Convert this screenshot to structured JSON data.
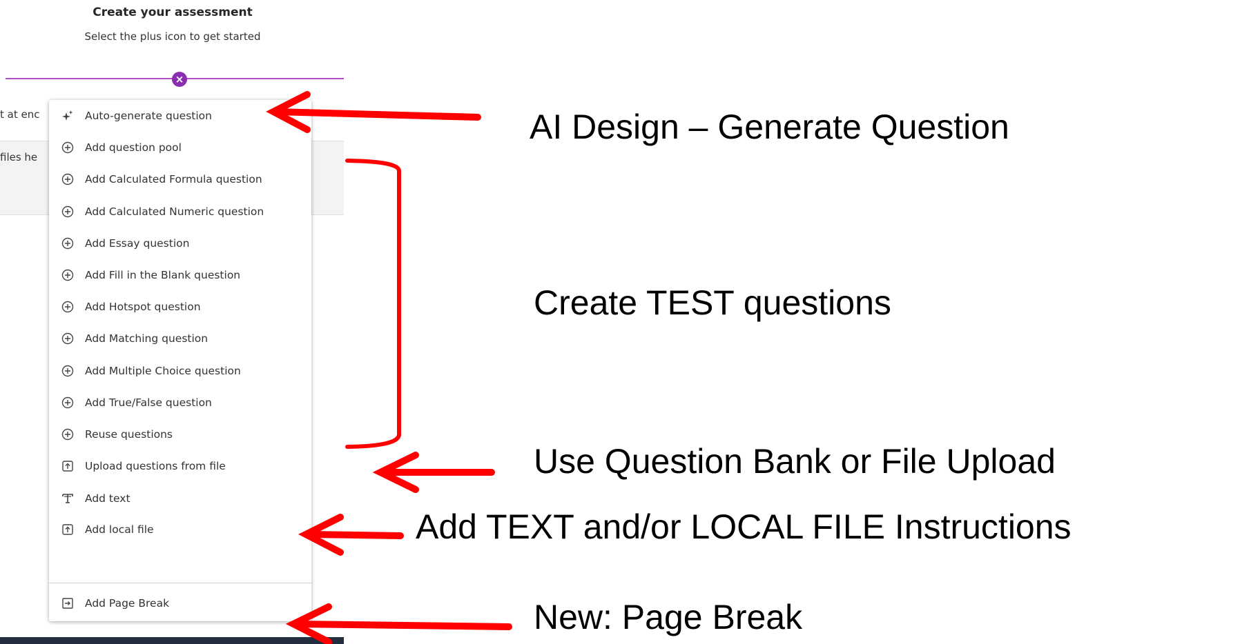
{
  "header": {
    "title": "Create your assessment",
    "subtitle": "Select the plus icon to get started"
  },
  "background": {
    "fragment_1": "t at enc",
    "fragment_2": "files he"
  },
  "menu": {
    "items": [
      {
        "label": "Auto-generate question",
        "icon": "sparkle-icon"
      },
      {
        "label": "Add question pool",
        "icon": "plus-circle-icon"
      },
      {
        "label": "Add Calculated Formula question",
        "icon": "plus-circle-icon"
      },
      {
        "label": "Add Calculated Numeric question",
        "icon": "plus-circle-icon"
      },
      {
        "label": "Add Essay question",
        "icon": "plus-circle-icon"
      },
      {
        "label": "Add Fill in the Blank question",
        "icon": "plus-circle-icon"
      },
      {
        "label": "Add Hotspot question",
        "icon": "plus-circle-icon"
      },
      {
        "label": "Add Matching question",
        "icon": "plus-circle-icon"
      },
      {
        "label": "Add Multiple Choice question",
        "icon": "plus-circle-icon"
      },
      {
        "label": "Add True/False question",
        "icon": "plus-circle-icon"
      },
      {
        "label": "Reuse questions",
        "icon": "plus-circle-icon"
      },
      {
        "label": "Upload questions from file",
        "icon": "upload-file-icon"
      },
      {
        "label": "Add text",
        "icon": "text-icon"
      },
      {
        "label": "Add local file",
        "icon": "upload-file-icon"
      },
      {
        "label": "Add Page Break",
        "icon": "page-break-icon"
      }
    ]
  },
  "annotations": {
    "ai_design": "AI Design – Generate Question",
    "test_questions": "Create TEST questions",
    "question_bank": "Use Question Bank or File Upload",
    "text_file": "Add TEXT and/or LOCAL FILE Instructions",
    "page_break": "New: Page Break"
  },
  "colors": {
    "accent_purple": "#8b2fb0",
    "line_purple": "#b44cc8",
    "annotation_red": "#ff0000"
  }
}
